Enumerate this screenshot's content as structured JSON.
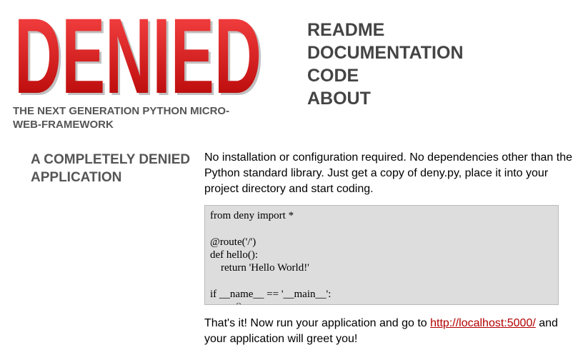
{
  "logo": {
    "text": "DENIED",
    "gradient_top": "#ff4a4a",
    "gradient_bottom": "#b00000"
  },
  "tagline": "THE NEXT GENERATION PYTHON MICRO-WEB-FRAMEWORK",
  "nav": {
    "readme": "README",
    "documentation": "DOCUMENTATION",
    "code": "CODE",
    "about": "ABOUT"
  },
  "section": {
    "title": "A COMPLETELY DENIED APPLICATION",
    "intro": "No installation or configuration required. No dependencies other than the Python standard library. Just get a copy of deny.py, place it into your project directory and start coding.",
    "code": "from deny import *\n\n@route('/')\ndef hello():\n    return 'Hello World!'\n\nif __name__ == '__main__':\n    run()",
    "outro_before": "That's it! Now run your application and go to ",
    "outro_link": "http://localhost:5000/",
    "outro_after": " and your application will greet you!"
  },
  "colors": {
    "link": "#b30000",
    "heading": "#555555",
    "nav": "#444444",
    "code_bg": "#dddddd"
  }
}
